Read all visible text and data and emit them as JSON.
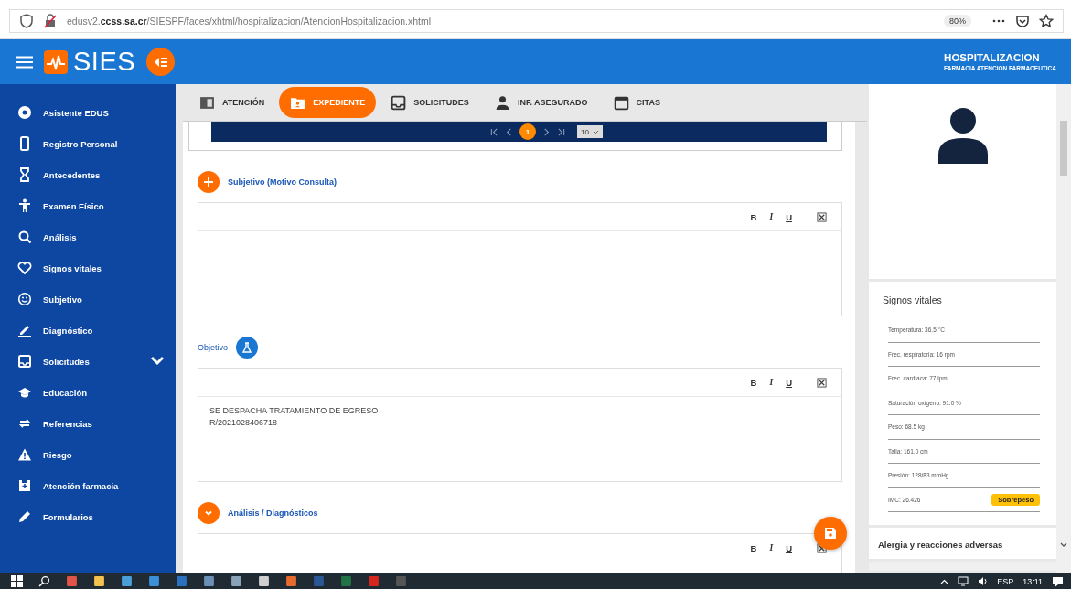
{
  "browser": {
    "url": "edusv2.**ccss.sa.cr**/SIESPF/faces/xhtml/hospitalizacion/AtencionHospitalizacion.xhtml",
    "zoom": "80%"
  },
  "header": {
    "app_name": "SIES",
    "context_title": "HOSPITALIZACION",
    "context_subtitle": "FARMACIA ATENCION FARMACEUTICA"
  },
  "sidebar": {
    "items": [
      {
        "label": "Asistente EDUS",
        "has_submenu": false
      },
      {
        "label": "Registro Personal",
        "has_submenu": false
      },
      {
        "label": "Antecedentes",
        "has_submenu": false
      },
      {
        "label": "Examen Físico",
        "has_submenu": false
      },
      {
        "label": "Análisis",
        "has_submenu": false
      },
      {
        "label": "Signos vitales",
        "has_submenu": false
      },
      {
        "label": "Subjetivo",
        "has_submenu": false
      },
      {
        "label": "Diagnóstico",
        "has_submenu": false
      },
      {
        "label": "Solicitudes",
        "has_submenu": true
      },
      {
        "label": "Educación",
        "has_submenu": false
      },
      {
        "label": "Referencias",
        "has_submenu": false
      },
      {
        "label": "Riesgo",
        "has_submenu": false
      },
      {
        "label": "Atención farmacia",
        "has_submenu": false
      },
      {
        "label": "Formularios",
        "has_submenu": false
      }
    ]
  },
  "tabs": [
    {
      "label": "ATENCIÓN",
      "selected": false
    },
    {
      "label": "EXPEDIENTE",
      "selected": true
    },
    {
      "label": "SOLICITUDES",
      "selected": false
    },
    {
      "label": "INF. ASEGURADO",
      "selected": false
    },
    {
      "label": "CITAS",
      "selected": false
    }
  ],
  "paginator": {
    "page": "1",
    "rows_per_page": "10"
  },
  "sections": [
    {
      "title": "Subjetivo (Motivo Consulta)",
      "kind": "add",
      "toolbar": [
        "B",
        "I",
        "U"
      ]
    },
    {
      "title": "Objetivo",
      "kind": "lab",
      "toolbar": [
        "B",
        "I",
        "U"
      ],
      "text": "SE DESPACHA TRATAMIENTO DE EGRESO\nR/2021028406718"
    },
    {
      "title": "Análisis / Diagnósticos",
      "kind": "toggle",
      "toolbar": [
        "B",
        "I",
        "U"
      ]
    }
  ],
  "vitals": {
    "title": "Signos vitales",
    "items": [
      {
        "reading": "Temperatura: 36.5 °C"
      },
      {
        "reading": "Frec. respiratoria: 16 rpm"
      },
      {
        "reading": "Frec. cardíaca: 77 lpm"
      },
      {
        "reading": "Saturación oxígeno: 91.0 %"
      },
      {
        "reading": "Peso: 68.5 kg"
      },
      {
        "reading": "Talla: 161.0 cm"
      },
      {
        "reading": "Presión: 128/83 mmHg"
      },
      {
        "reading": "IMC: 26.426",
        "badge": "Sobrepeso"
      }
    ]
  },
  "allergies": {
    "title": "Alergia y reacciones adversas"
  },
  "taskbar": {
    "language": "ESP",
    "time": "13:11"
  }
}
